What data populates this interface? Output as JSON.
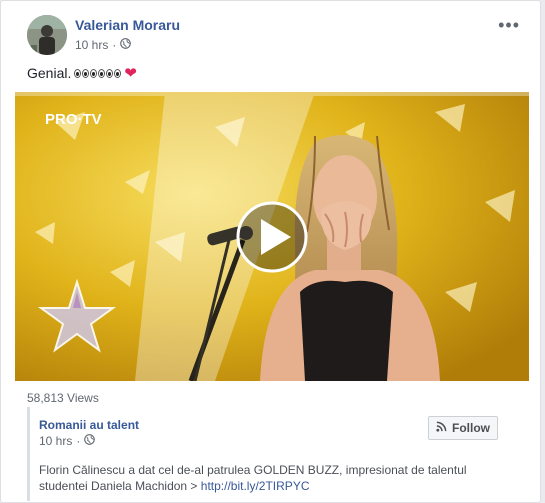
{
  "post": {
    "author": "Valerian Moraru",
    "time": "10 hrs",
    "separator": "·",
    "text": "Genial.",
    "more": "•••"
  },
  "video": {
    "channel_logo": "PRO·TV",
    "views": "58,813 Views"
  },
  "shared": {
    "page_name": "Romanii au talent",
    "time": "10 hrs",
    "separator": "·",
    "follow_label": "Follow",
    "description": "Florin Călinescu a dat cel de-al patrulea GOLDEN BUZZ, impresionat de talentul studentei Daniela Machidon > ",
    "link": "http://bit.ly/2TIRPYC"
  },
  "icons": {
    "privacy": "globe-icon",
    "more": "more-options-icon",
    "follow": "rss-icon",
    "play": "play-icon",
    "heart": "heart-icon",
    "eyes": "eyes-emoji-icon"
  },
  "colors": {
    "link_blue": "#385898",
    "heart_red": "#e0245e",
    "stage_gold": "#d9a70f"
  }
}
